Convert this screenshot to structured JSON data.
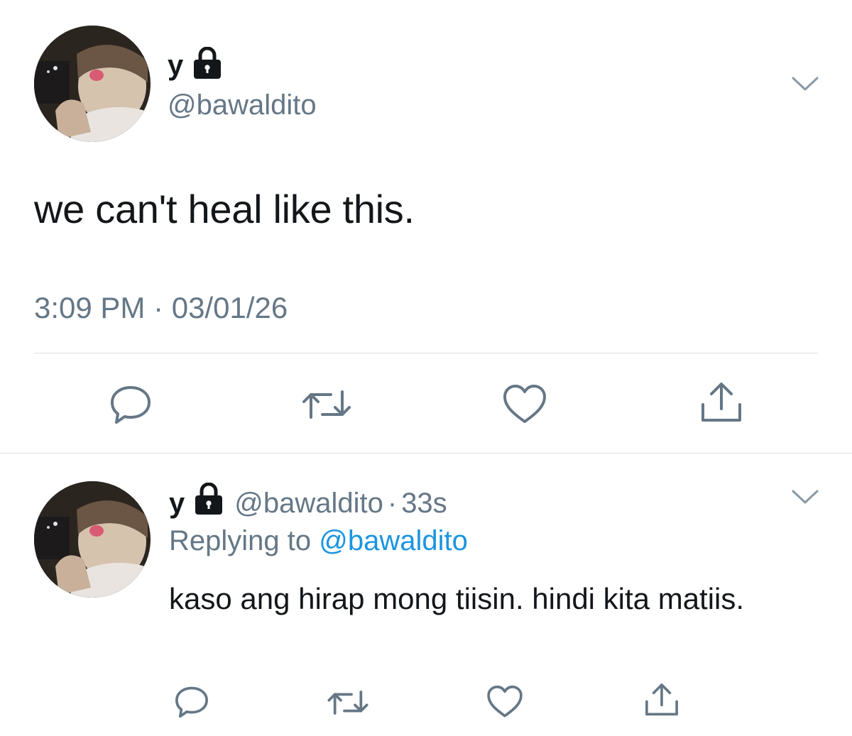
{
  "main_tweet": {
    "display_name": "y",
    "handle": "@bawaldito",
    "text": "we can't heal like this.",
    "timestamp": "3:09 PM · 03/01/26",
    "protected_icon": "lock-icon",
    "menu_icon": "chevron-down-icon",
    "actions": [
      "reply-icon",
      "retweet-icon",
      "like-icon",
      "share-icon"
    ]
  },
  "reply_tweet": {
    "display_name": "y",
    "handle": "@bawaldito",
    "separator": "·",
    "time_ago": "33s",
    "replying_prefix": "Replying to",
    "replying_to": "@bawaldito",
    "text": "kaso ang hirap mong tiisin. hindi kita matiis.",
    "protected_icon": "lock-icon",
    "menu_icon": "chevron-down-icon",
    "actions": [
      "reply-icon",
      "retweet-icon",
      "like-icon",
      "share-icon"
    ]
  },
  "colors": {
    "text_primary": "#14171a",
    "text_secondary": "#657786",
    "link": "#1b95e0",
    "icon": "#657786",
    "divider": "#d8dde2"
  }
}
